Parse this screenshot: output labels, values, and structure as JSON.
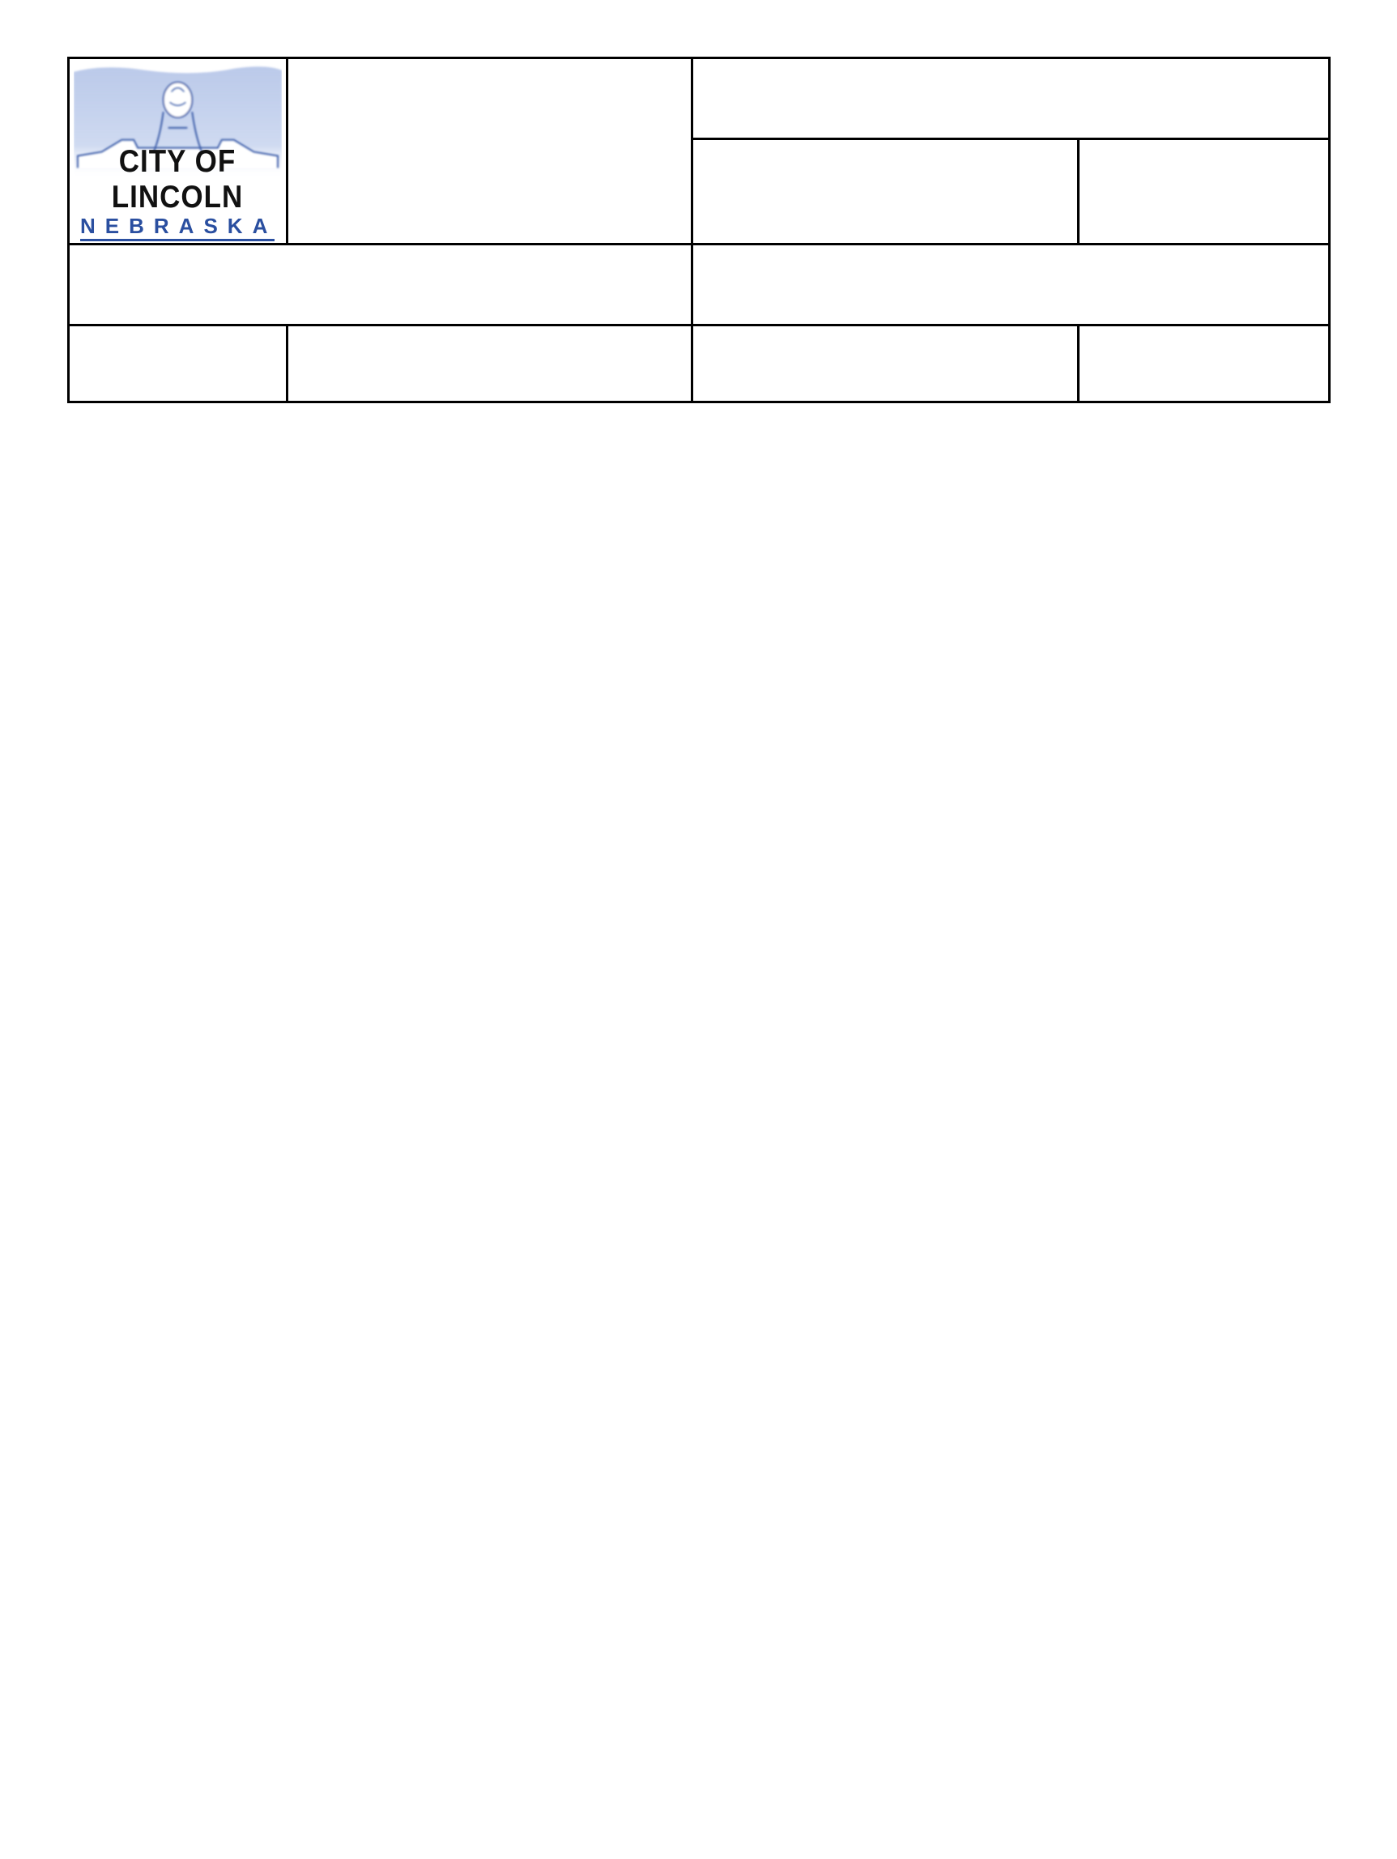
{
  "logo": {
    "line1": "CITY OF LINCOLN",
    "line2": "NEBRASKA"
  },
  "cells": {
    "r1c2": "",
    "r1c3": "",
    "r1c4a": "",
    "r1c4b": "",
    "r2c1": "",
    "r2c2": "",
    "r3c1": "",
    "r3c2": "",
    "r3c3": "",
    "r3c4": ""
  }
}
